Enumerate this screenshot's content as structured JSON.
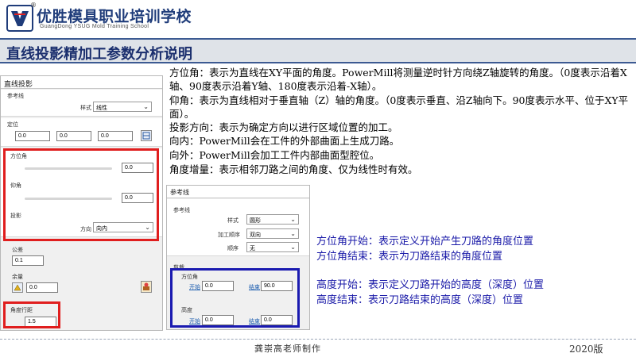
{
  "header": {
    "brand_title": "优胜模具职业培训学校",
    "brand_subtitle": "GuangDong YSUG Mold Training School",
    "registered": "®",
    "slide_title": "直线投影精加工参数分析说明"
  },
  "panel1": {
    "title": "直线投影",
    "reference_label": "参考线",
    "style_label": "样式",
    "style_value": "线性",
    "position_label": "定位",
    "pos_values": [
      "0.0",
      "0.0",
      "0.0"
    ],
    "azimuth_label": "方位角",
    "azimuth_value": "0.0",
    "elevation_label": "仰角",
    "elevation_value": "0.0",
    "projection_label": "投影",
    "direction_label": "方向",
    "direction_value": "向内",
    "tolerance_label": "公差",
    "tolerance_value": "0.1",
    "thickness_label": "余量",
    "thickness_value": "0.0",
    "stepover_label": "角度行距",
    "stepover_value": "1.5"
  },
  "panel2": {
    "title": "参考线",
    "reference_label": "参考线",
    "style_label": "样式",
    "style_value": "圆形",
    "order_label": "加工顺序",
    "order_value": "双向",
    "ordering_label": "顺序",
    "ordering_value": "无",
    "limits_label": "剪裁",
    "azimuth_label": "方位角",
    "start_link": "开始",
    "start_value": "0.0",
    "end_link": "结束",
    "end_value": "90.0",
    "height_label": "高度",
    "height_start_link": "开始",
    "height_start_value": "0.0",
    "height_end_link": "结束",
    "height_end_value": "0.0"
  },
  "description": [
    "方位角：表示为直线在XY平面的角度。PowerMill将测量逆时针方向绕Z轴旋转的角度。（0度表示沿着X轴、90度表示沿着Y轴、180度表示沿着-X轴）。",
    "仰角：表示为直线相对于垂直轴（Z）轴的角度。（0度表示垂直、沿Z轴向下。90度表示水平、位于XY平面）。",
    "投影方向：表示为确定方向以进行区域位置的加工。",
    "向内：PowerMill会在工件的外部曲面上生成刀路。",
    "向外：PowerMill会加工工件内部曲面型腔位。",
    "角度增量：表示相邻刀路之间的角度、仅为线性时有效。"
  ],
  "notes_azimuth": [
    "方位角开始：表示定义开始产生刀路的角度位置",
    "方位角结束：表示为刀路结束的角度位置"
  ],
  "notes_height": [
    "高度开始：表示定义刀路开始的高度（深度）位置",
    "高度结束：表示刀路结束的高度（深度）位置"
  ],
  "footer": {
    "author": "龚崇高老师制作",
    "version": "2020版"
  },
  "colors": {
    "title_bar_border": "#3c5a92",
    "red_highlight": "#e01e1e",
    "blue_highlight": "#1a1ab0",
    "note_text": "#1a1aa8"
  }
}
